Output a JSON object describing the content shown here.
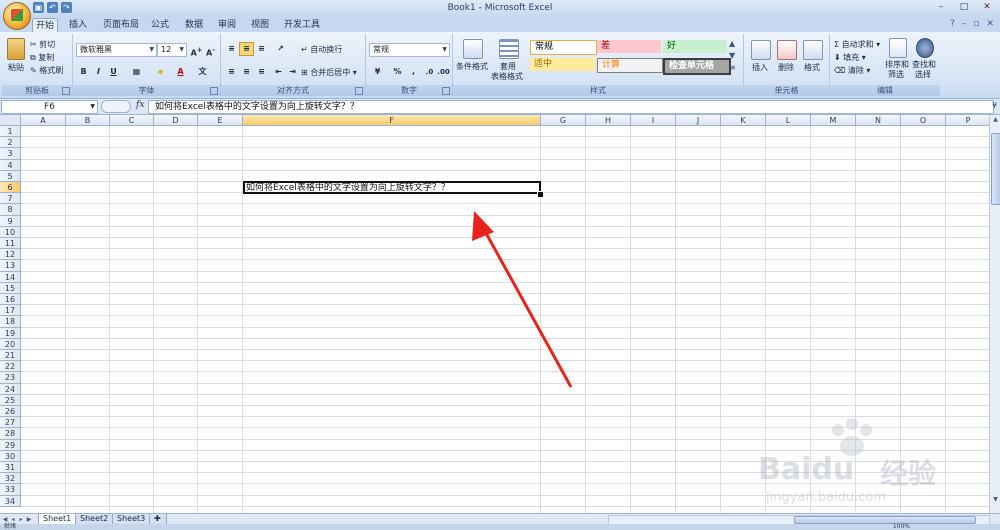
{
  "window": {
    "title": "Book1 - Microsoft Excel"
  },
  "tabs": [
    "开始",
    "插入",
    "页面布局",
    "公式",
    "数据",
    "审阅",
    "视图",
    "开发工具"
  ],
  "ribbon": {
    "clipboard": {
      "paste": "粘贴",
      "cut": "剪切",
      "copy": "复制",
      "format_painter": "格式刷",
      "label": "剪贴板"
    },
    "font": {
      "name": "微软雅黑",
      "size": "12",
      "label": "字体",
      "bold": "B",
      "italic": "I",
      "underline": "U"
    },
    "alignment": {
      "wrap": "自动换行",
      "merge": "合并后居中",
      "label": "对齐方式"
    },
    "number": {
      "format": "常规",
      "percent": "%",
      "label": "数字"
    },
    "styles": {
      "conditional": "条件格式",
      "table_format_line1": "套用",
      "table_format_line2": "表格格式",
      "normal": "常规",
      "bad": "差",
      "good": "好",
      "neutral": "适中",
      "calculation": "计算",
      "check_cell": "检查单元格",
      "label": "样式"
    },
    "cells": {
      "insert": "插入",
      "delete": "删除",
      "format": "格式",
      "label": "单元格"
    },
    "editing": {
      "autosum": "自动求和",
      "fill": "填充",
      "clear": "清除",
      "sort_line1": "排序和",
      "sort_line2": "筛选",
      "find_line1": "查找和",
      "find_line2": "选择",
      "label": "编辑"
    }
  },
  "formula_bar": {
    "name_box": "F6",
    "fx": "fx",
    "content": "如何将Excel表格中的文字设置为向上旋转文字？？"
  },
  "grid": {
    "columns": [
      "A",
      "B",
      "C",
      "D",
      "E",
      "F",
      "G",
      "H",
      "I",
      "J",
      "K",
      "L",
      "M",
      "N",
      "O",
      "P"
    ],
    "rows": [
      "1",
      "2",
      "3",
      "4",
      "5",
      "6",
      "7",
      "8",
      "9",
      "10",
      "11",
      "12",
      "13",
      "14",
      "15",
      "16",
      "17",
      "18",
      "19",
      "20",
      "21",
      "22",
      "23",
      "24",
      "25",
      "26",
      "27",
      "28",
      "29",
      "30",
      "31",
      "32",
      "33",
      "34"
    ],
    "selected_column": "F",
    "selected_row": "6",
    "cell_F6": "如何将Excel表格中的文字设置为向上旋转文字？？"
  },
  "sheets": [
    "Sheet1",
    "Sheet2",
    "Sheet3"
  ],
  "active_sheet": "Sheet1",
  "status": {
    "ready": "就绪",
    "zoom": "100%"
  },
  "watermark": {
    "brand": "Baidu",
    "brand_cn": "经验",
    "url": "jingyan.baidu.com"
  },
  "colors": {
    "arrow": "#e8231c",
    "active_header": "#f9c967",
    "grid_line": "#d6dde7"
  }
}
